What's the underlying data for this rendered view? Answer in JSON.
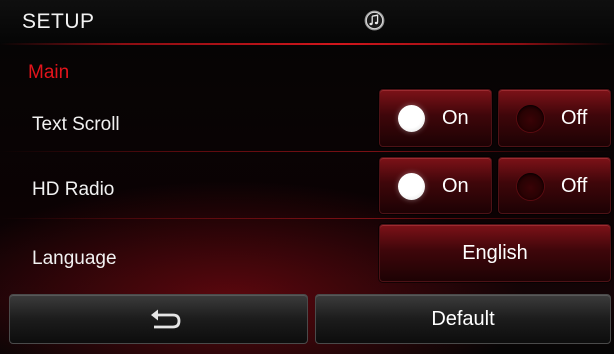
{
  "header": {
    "title": "SETUP",
    "center_icon": "music-note-icon"
  },
  "main": {
    "section_title": "Main",
    "rows": [
      {
        "label": "Text Scroll",
        "on_label": "On",
        "off_label": "Off",
        "selected": "On"
      },
      {
        "label": "HD Radio",
        "on_label": "On",
        "off_label": "Off",
        "selected": "On"
      },
      {
        "label": "Language",
        "value": "English"
      }
    ]
  },
  "footer": {
    "back_icon": "back-arrow-icon",
    "default_label": "Default"
  },
  "colors": {
    "accent_red": "#e3141b",
    "button_red": "#7d1218",
    "background": "#050505"
  }
}
